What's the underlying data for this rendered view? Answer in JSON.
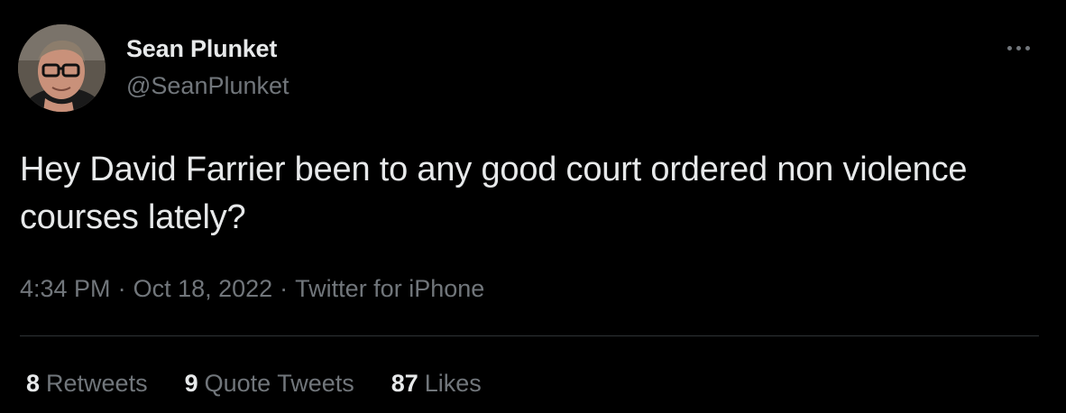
{
  "author": {
    "display_name": "Sean Plunket",
    "handle": "@SeanPlunket"
  },
  "tweet": {
    "text": "Hey David Farrier been to any good court ordered non violence courses lately?",
    "time": "4:34 PM",
    "date": "Oct 18, 2022",
    "source": "Twitter for iPhone",
    "separator": "·"
  },
  "stats": {
    "retweets": {
      "count": "8",
      "label": "Retweets"
    },
    "quote_tweets": {
      "count": "9",
      "label": "Quote Tweets"
    },
    "likes": {
      "count": "87",
      "label": "Likes"
    }
  },
  "icons": {
    "more": "more-dots-icon",
    "avatar": "profile-photo"
  },
  "colors": {
    "background": "#000000",
    "primary_text": "#e7e9ea",
    "secondary_text": "#71767b",
    "divider": "#2f3336"
  }
}
